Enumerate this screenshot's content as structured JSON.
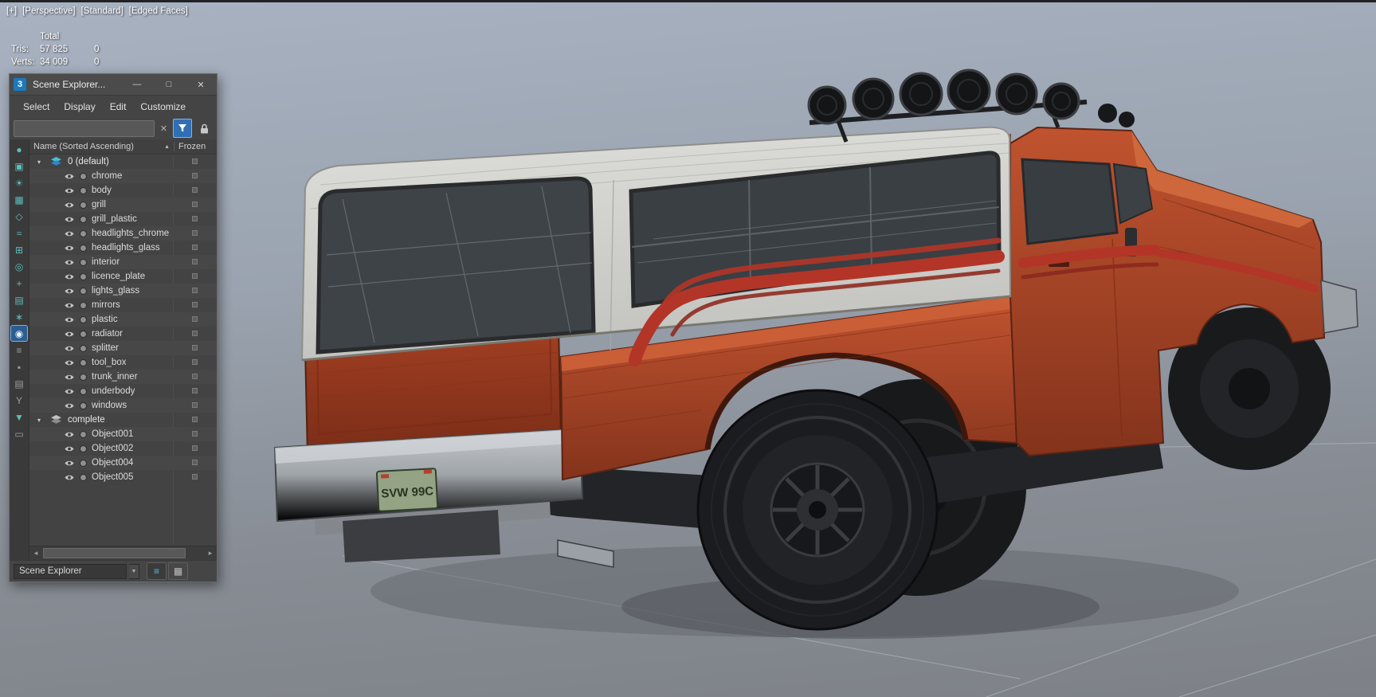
{
  "viewport": {
    "label_segments": [
      "[+]",
      "[Perspective]",
      "[Standard]",
      "[Edged Faces]"
    ],
    "stats": {
      "total_header": "Total",
      "rows": [
        {
          "label": "Tris:",
          "value": "57 825",
          "selection": "0"
        },
        {
          "label": "Verts:",
          "value": "34 009",
          "selection": "0"
        }
      ]
    },
    "license_plate": "SVW 99C"
  },
  "scene_explorer": {
    "app_icon": "3",
    "title": "Scene Explorer...",
    "window_buttons": [
      {
        "name": "minimize-button",
        "glyph": "—"
      },
      {
        "name": "maximize-button",
        "glyph": "□"
      },
      {
        "name": "close-button",
        "glyph": "✕"
      }
    ],
    "menu": [
      "Select",
      "Display",
      "Edit",
      "Customize"
    ],
    "search": {
      "value": "",
      "clear_icon": "✕"
    },
    "header": {
      "name": "Name (Sorted Ascending)",
      "sort_icon": "▲",
      "frozen": "Frozen"
    },
    "expand_icon": "▾",
    "side_toolbar": [
      {
        "name": "display-none-icon",
        "glyph": "●"
      },
      {
        "name": "display-geometry-icon",
        "glyph": "▣"
      },
      {
        "name": "display-lights-icon",
        "glyph": "☀"
      },
      {
        "name": "display-cameras-icon",
        "glyph": "▦"
      },
      {
        "name": "display-shapes-icon",
        "glyph": "◇"
      },
      {
        "name": "display-spacewarps-icon",
        "glyph": "≈"
      },
      {
        "name": "display-groups-icon",
        "glyph": "⊞"
      },
      {
        "name": "display-xrefs-icon",
        "glyph": "◎"
      },
      {
        "name": "display-helpers-icon",
        "glyph": "+"
      },
      {
        "name": "display-containers-icon",
        "glyph": "▤"
      },
      {
        "name": "display-systems-icon",
        "glyph": "∗"
      },
      {
        "name": "display-frozen-eye-icon",
        "glyph": "◉",
        "active": true
      },
      {
        "name": "display-list-icon",
        "glyph": "≡",
        "gray": true
      },
      {
        "name": "display-materials-icon",
        "glyph": "▪",
        "gray": true
      },
      {
        "name": "display-properties-icon",
        "glyph": "▤",
        "gray": true
      },
      {
        "name": "display-bones-icon",
        "glyph": "Y",
        "gray": true
      },
      {
        "name": "selection-filter-icon",
        "glyph": "▼"
      },
      {
        "name": "display-bag-icon",
        "glyph": "▭",
        "gray": true
      }
    ],
    "tree": [
      {
        "label": "0 (default)",
        "icon": "layers-teal",
        "children": [
          "chrome",
          "body",
          "grill",
          "grill_plastic",
          "headlights_chrome",
          "headlights_glass",
          "interior",
          "licence_plate",
          "lights_glass",
          "mirrors",
          "plastic",
          "radiator",
          "splitter",
          "tool_box",
          "trunk_inner",
          "underbody",
          "windows"
        ]
      },
      {
        "label": "complete",
        "icon": "layers-gray",
        "children": [
          "Object001",
          "Object002",
          "Object004",
          "Object005"
        ]
      }
    ],
    "scrollbar": {
      "left_arrow": "◂",
      "right_arrow": "▸"
    },
    "footer": {
      "selector_value": "Scene Explorer",
      "dropdown_icon": "▼",
      "buttons": [
        {
          "name": "sort-by-layer-button",
          "glyph": "≡",
          "teal": true
        },
        {
          "name": "sort-by-hierarchy-button",
          "glyph": "▦"
        }
      ]
    }
  }
}
